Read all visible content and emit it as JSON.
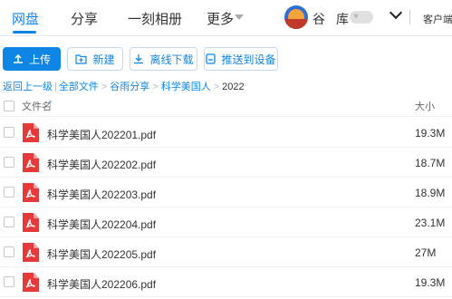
{
  "nav": {
    "tabs": [
      {
        "label": "网盘",
        "active": true
      },
      {
        "label": "分享",
        "active": false
      },
      {
        "label": "一刻相册",
        "active": false
      },
      {
        "label": "更多",
        "active": false
      }
    ],
    "user_name": "谷",
    "library_label": "库",
    "client_label": "客户端"
  },
  "toolbar": {
    "upload_label": "上传",
    "new_label": "新建",
    "offline_download_label": "离线下载",
    "push_to_device_label": "推送到设备"
  },
  "breadcrumb": {
    "back_label": "返回上一级",
    "all_files_label": "全部文件",
    "items": [
      "谷雨分享",
      "科学美国人"
    ],
    "current": "2022"
  },
  "table": {
    "col_name": "文件名",
    "col_size": "大小",
    "sort_arrow": "↑",
    "rows": [
      {
        "name": "科学美国人202201.pdf",
        "size": "19.3M"
      },
      {
        "name": "科学美国人202202.pdf",
        "size": "18.7M"
      },
      {
        "name": "科学美国人202203.pdf",
        "size": "18.9M"
      },
      {
        "name": "科学美国人202204.pdf",
        "size": "23.1M"
      },
      {
        "name": "科学美国人202205.pdf",
        "size": "27M"
      },
      {
        "name": "科学美国人202206.pdf",
        "size": "19.3M"
      }
    ]
  },
  "colors": {
    "accent": "#0f86e5",
    "pdf_red": "#e5393a"
  },
  "icons": {
    "upload": "upload-icon",
    "new": "new-folder-icon",
    "download": "download-icon",
    "device": "device-icon",
    "file": "pdf-file-icon"
  }
}
